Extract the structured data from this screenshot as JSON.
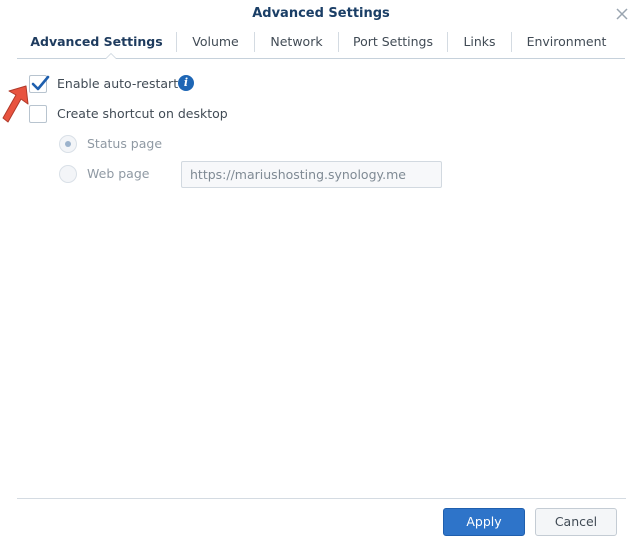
{
  "window": {
    "title": "Advanced Settings",
    "close_icon": "close-icon"
  },
  "tabs": [
    {
      "label": "Advanced Settings",
      "active": true
    },
    {
      "label": "Volume",
      "active": false
    },
    {
      "label": "Network",
      "active": false
    },
    {
      "label": "Port Settings",
      "active": false
    },
    {
      "label": "Links",
      "active": false
    },
    {
      "label": "Environment",
      "active": false
    }
  ],
  "options": {
    "auto_restart": {
      "label": "Enable auto-restart",
      "checked": true,
      "info_icon": "info-icon"
    },
    "desktop_shortcut": {
      "label": "Create shortcut on desktop",
      "checked": false
    }
  },
  "shortcut_target": {
    "status_page": {
      "label": "Status page",
      "selected": true,
      "disabled": true
    },
    "web_page": {
      "label": "Web page",
      "selected": false,
      "disabled": true
    },
    "url_value": "https://mariushosting.synology.me"
  },
  "footer": {
    "apply_label": "Apply",
    "cancel_label": "Cancel"
  },
  "colors": {
    "accent": "#2e74c9",
    "title": "#1a3e66",
    "annotation_arrow": "#e8533f"
  }
}
